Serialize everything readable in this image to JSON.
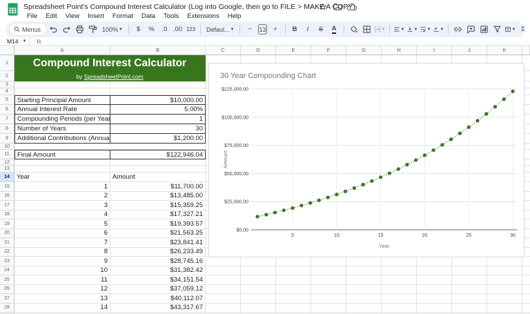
{
  "titlebar": {
    "doc_title": "Spreadsheet Point's Compound Interest Calculator (Log into Google, then go to FILE > MAKE A COPY)",
    "action_icons": [
      "star-icon",
      "move-folder-icon",
      "cloud-saved-icon"
    ],
    "menus": [
      "File",
      "Edit",
      "View",
      "Insert",
      "Format",
      "Data",
      "Tools",
      "Extensions",
      "Help"
    ]
  },
  "toolbar": {
    "menus_label": "Menus",
    "zoom_value": "100%",
    "currency_label": "$",
    "percent_label": "%",
    "decrease_decimals_label": ".0",
    "increase_decimals_label": ".00",
    "more_formats_label": "123",
    "font_name": "Defaul...",
    "minus_label": "−",
    "font_size": "13",
    "plus_label": "+",
    "bold_label": "B",
    "italic_label": "I",
    "strikethrough_label": "S",
    "text_color_label": "A",
    "functions_label": "Σ",
    "icon_items": [
      "undo-icon",
      "redo-icon",
      "print-icon",
      "paint-format-icon"
    ]
  },
  "formula_bar": {
    "name_box": "M14",
    "fx_label": "fx"
  },
  "sheet": {
    "column_headers": [
      "A",
      "B",
      "C",
      "D",
      "E",
      "F",
      "G",
      "H",
      "I",
      "J",
      "K"
    ],
    "selected_row": 14,
    "accent_green": "#38761d",
    "rows": [
      {
        "n": 1,
        "type": "banner-title",
        "text": "Compound Interest Calculator"
      },
      {
        "n": 2,
        "type": "banner-subtitle",
        "prefix": "by ",
        "link": "SpreadsheetPoint.com"
      },
      {
        "n": 3
      },
      {
        "n": 4
      },
      {
        "n": 5,
        "type": "input",
        "label": "Starting Principal Amount",
        "value": "$10,000.00"
      },
      {
        "n": 6,
        "type": "input",
        "label": "Annual Interest Rate",
        "value": "5.00%"
      },
      {
        "n": 7,
        "type": "input",
        "label": "Compounding Periods (per Year)",
        "value": "1"
      },
      {
        "n": 8,
        "type": "input",
        "label": "Number of Years",
        "value": "30"
      },
      {
        "n": 9,
        "type": "input",
        "label": "Additional Contributions (Annual)",
        "value": "$1,200.00"
      },
      {
        "n": 10
      },
      {
        "n": 11,
        "type": "result",
        "label": "Final Amount",
        "value": "$122,946.04"
      },
      {
        "n": 12
      },
      {
        "n": 13
      },
      {
        "n": 14,
        "type": "table-header",
        "label": "Year",
        "value": "Amount"
      },
      {
        "n": 15,
        "type": "table-row",
        "label": "1",
        "value": "$11,700.00"
      },
      {
        "n": 16,
        "type": "table-row",
        "label": "2",
        "value": "$13,485.00"
      },
      {
        "n": 17,
        "type": "table-row",
        "label": "3",
        "value": "$15,359.25"
      },
      {
        "n": 18,
        "type": "table-row",
        "label": "4",
        "value": "$17,327.21"
      },
      {
        "n": 19,
        "type": "table-row",
        "label": "5",
        "value": "$19,393.57"
      },
      {
        "n": 20,
        "type": "table-row",
        "label": "6",
        "value": "$21,563.25"
      },
      {
        "n": 21,
        "type": "table-row",
        "label": "7",
        "value": "$23,841.41"
      },
      {
        "n": 22,
        "type": "table-row",
        "label": "8",
        "value": "$26,233.49"
      },
      {
        "n": 23,
        "type": "table-row",
        "label": "9",
        "value": "$28,745.16"
      },
      {
        "n": 24,
        "type": "table-row",
        "label": "10",
        "value": "$31,382.42"
      },
      {
        "n": 25,
        "type": "table-row",
        "label": "11",
        "value": "$34,151.54"
      },
      {
        "n": 26,
        "type": "table-row",
        "label": "12",
        "value": "$37,059.12"
      },
      {
        "n": 27,
        "type": "table-row",
        "label": "13",
        "value": "$40,112.07"
      },
      {
        "n": 28,
        "type": "table-row",
        "label": "14",
        "value": "$43,317.67"
      }
    ]
  },
  "chart_data": {
    "type": "scatter",
    "title": "30 Year Compounding Chart",
    "xlabel": "Year",
    "ylabel": "Amount",
    "x": [
      1,
      2,
      3,
      4,
      5,
      6,
      7,
      8,
      9,
      10,
      11,
      12,
      13,
      14,
      15,
      16,
      17,
      18,
      19,
      20,
      21,
      22,
      23,
      24,
      25,
      26,
      27,
      28,
      29,
      30
    ],
    "values": [
      11700.0,
      13485.0,
      15359.25,
      17327.21,
      19393.57,
      21563.25,
      23841.41,
      26233.49,
      28745.16,
      31382.42,
      34151.54,
      37059.12,
      40112.07,
      43317.67,
      46683.56,
      50217.74,
      53928.62,
      57825.05,
      61916.31,
      66212.12,
      70722.73,
      75458.86,
      80431.81,
      85653.4,
      91136.07,
      96892.87,
      102937.51,
      109284.39,
      115948.61,
      122946.04
    ],
    "ylim": [
      0,
      125000
    ],
    "y_ticks": [
      0,
      25000,
      50000,
      75000,
      100000,
      125000
    ],
    "y_tick_labels": [
      "$0.00",
      "$25,000.00",
      "$50,000.00",
      "$75,000.00",
      "$100,000.00",
      "$125,000.00"
    ],
    "x_ticks": [
      5,
      10,
      15,
      20,
      25,
      30
    ],
    "grid": true,
    "point_color": "#38761d",
    "line_style": "dotted",
    "legend_position": "none"
  }
}
